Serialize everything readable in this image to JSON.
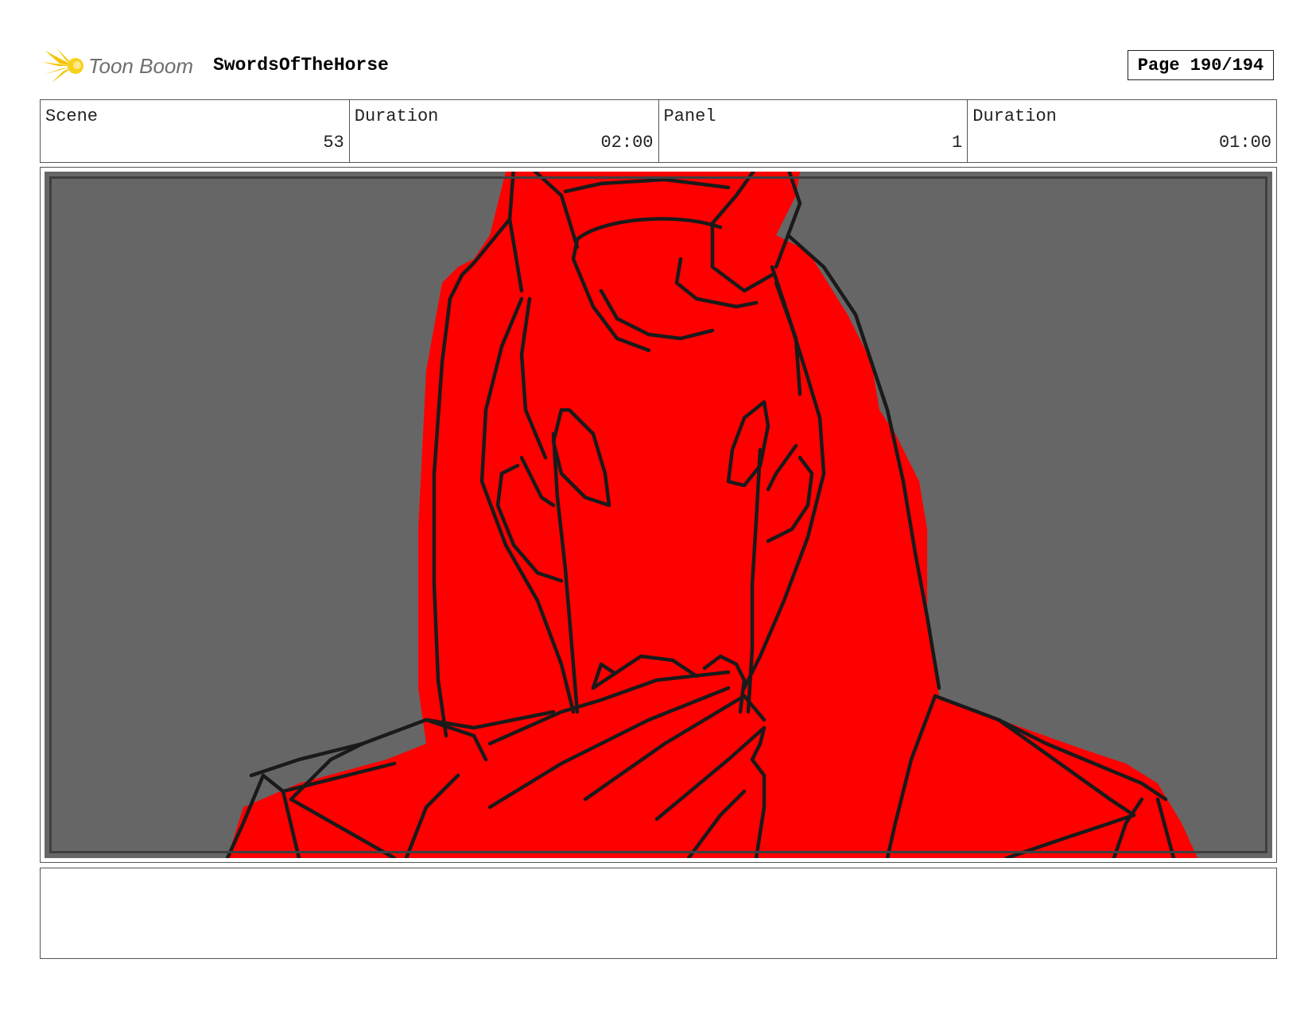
{
  "header": {
    "logo_text": "Toon Boom",
    "project_title": "SwordsOfTheHorse",
    "page_label": "Page 190/194"
  },
  "info": {
    "scene_label": "Scene",
    "scene_value": "53",
    "scene_duration_label": "Duration",
    "scene_duration_value": "02:00",
    "panel_label": "Panel",
    "panel_value": "1",
    "panel_duration_label": "Duration",
    "panel_duration_value": "01:00"
  },
  "colors": {
    "background": "#666666",
    "character_fill": "#ff0000",
    "line_art": "#1a1a1a",
    "logo_accent": "#f5c400"
  },
  "notes": {
    "text": ""
  }
}
